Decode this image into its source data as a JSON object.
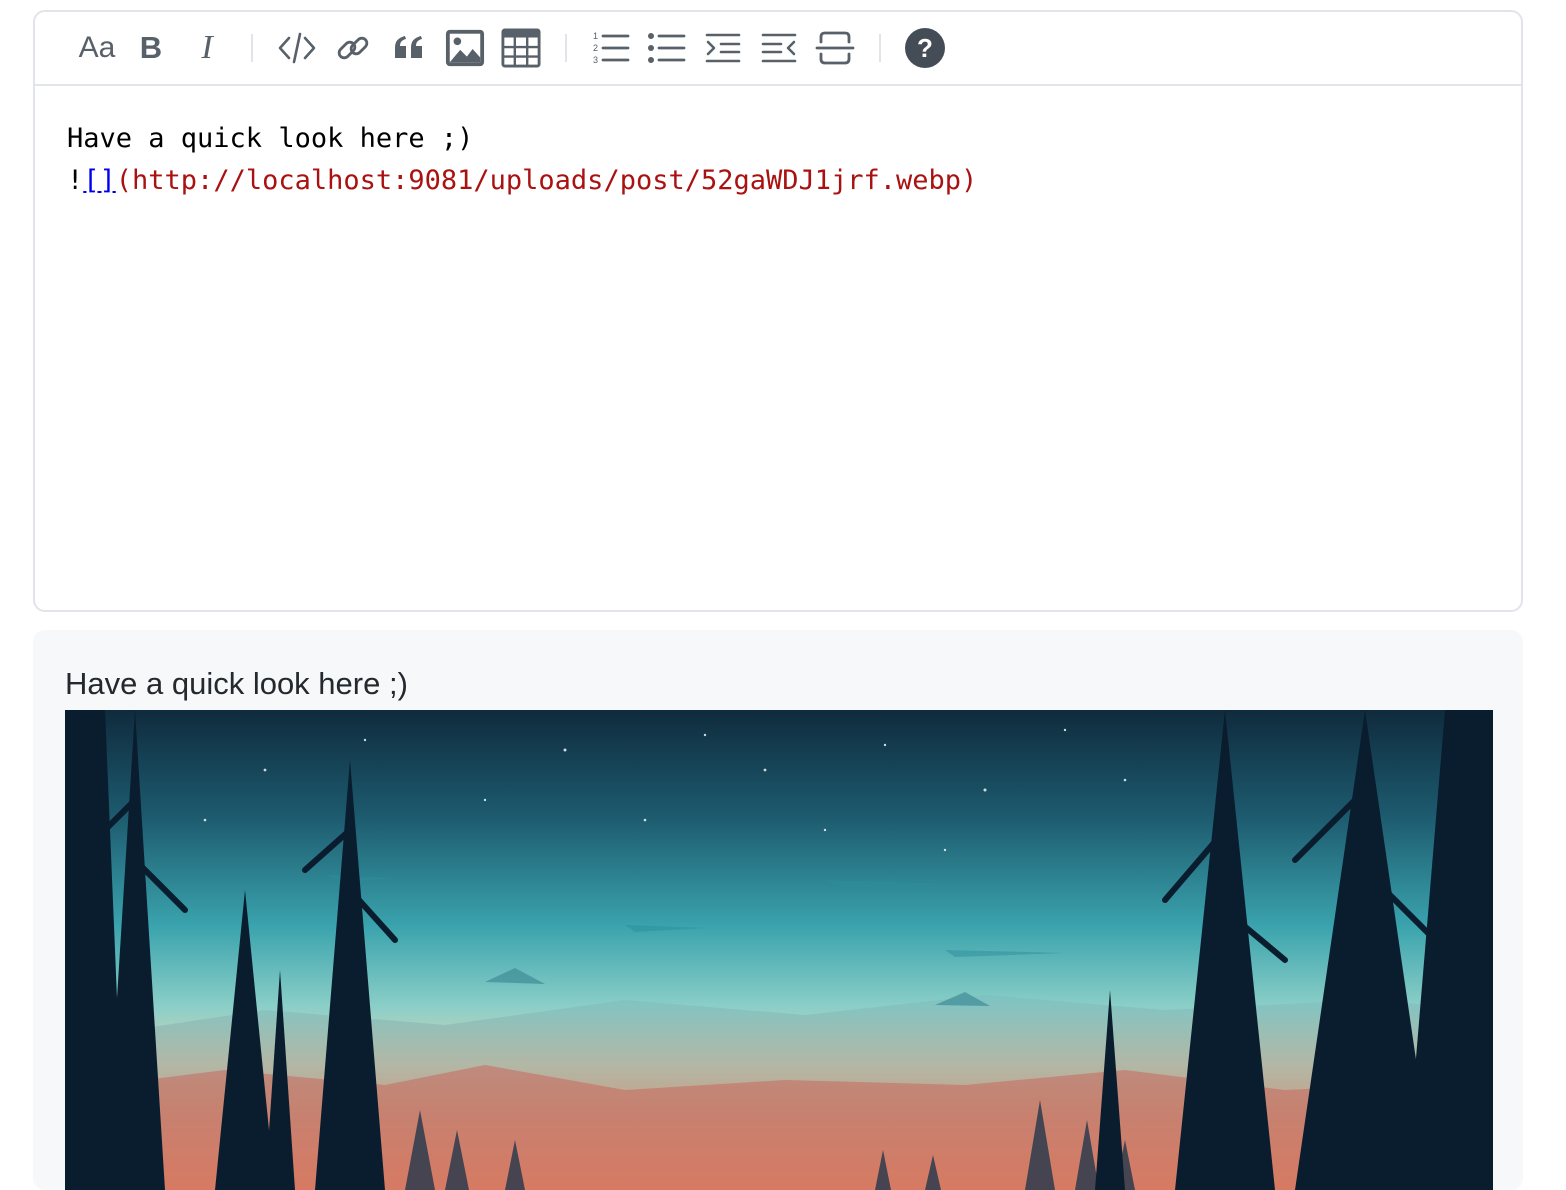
{
  "toolbar": {
    "heading_label": "Aa",
    "bold_label": "B",
    "italic_label": "I"
  },
  "editor": {
    "line1": "Have a quick look here ;)",
    "line2_prefix": "!",
    "line2_brackets": "[]",
    "line2_url": "(http://localhost:9081/uploads/post/52gaWDJ1jrf.webp)"
  },
  "preview": {
    "text": "Have a quick look here ;)"
  },
  "colors": {
    "url": "#aa1111",
    "link": "#0000ee",
    "icon": "#586069",
    "help": "#444d56"
  }
}
